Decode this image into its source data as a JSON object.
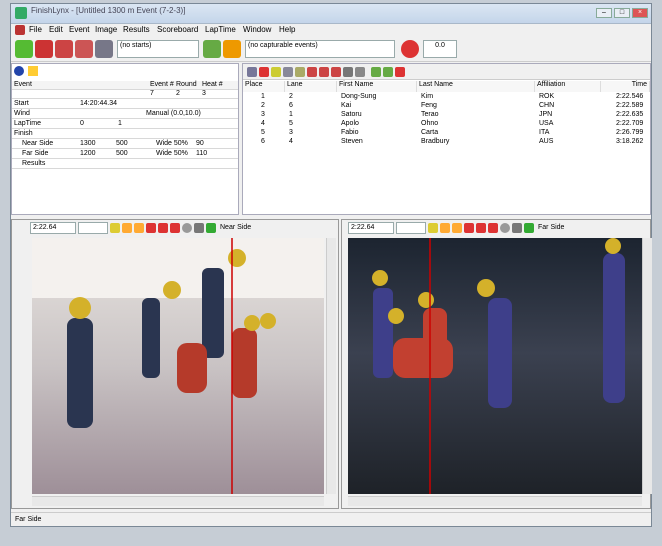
{
  "window": {
    "title": "FinishLynx - [Untitled 1300 m Event (7-2-3)]"
  },
  "menu": [
    "File",
    "Edit",
    "Event",
    "Image",
    "Results",
    "Scoreboard",
    "LapTime",
    "Window",
    "Help"
  ],
  "toolbar": {
    "starts": "(no starts)",
    "capturable": "(no capturable events)",
    "value": "0.0"
  },
  "event_grid": {
    "header": {
      "event": "Event",
      "event_no": "Event #",
      "round": "Round",
      "heat": "Heat #"
    },
    "values": {
      "event_no": "7",
      "round": "2",
      "heat": "3"
    },
    "start": {
      "label": "Start",
      "value": "14:20:44.34"
    },
    "wind": {
      "label": "Wind",
      "value": "Manual (0.0,10.0)"
    },
    "laptime": {
      "label": "LapTime",
      "a": "0",
      "b": "1"
    },
    "finish": {
      "label": "Finish"
    },
    "near": {
      "label": "Near Side",
      "a": "1300",
      "b": "500",
      "wide": "Wide 50%",
      "c": "90"
    },
    "far": {
      "label": "Far Side",
      "a": "1200",
      "b": "500",
      "wide": "Wide 50%",
      "c": "110"
    },
    "results": {
      "label": "Results"
    }
  },
  "results_table": {
    "columns": [
      "Place",
      "Lane",
      "First Name",
      "Last Name",
      "Affiliation",
      "Time"
    ],
    "rows": [
      [
        "1",
        "2",
        "Dong-Sung",
        "Kim",
        "ROK",
        "2:22.546"
      ],
      [
        "2",
        "6",
        "Kai",
        "Feng",
        "CHN",
        "2:22.589"
      ],
      [
        "3",
        "1",
        "Satoru",
        "Terao",
        "JPN",
        "2:22.635"
      ],
      [
        "4",
        "5",
        "Apolo",
        "Ohno",
        "USA",
        "2:22.709"
      ],
      [
        "5",
        "3",
        "Fabio",
        "Carta",
        "ITA",
        "2:26.799"
      ],
      [
        "6",
        "4",
        "Steven",
        "Bradbury",
        "AUS",
        "3:18.262"
      ]
    ]
  },
  "image_left": {
    "time": "2:22.64",
    "label": "Near Side"
  },
  "image_right": {
    "time": "2:22.64",
    "label": "Far Side"
  },
  "status": "Far Side"
}
